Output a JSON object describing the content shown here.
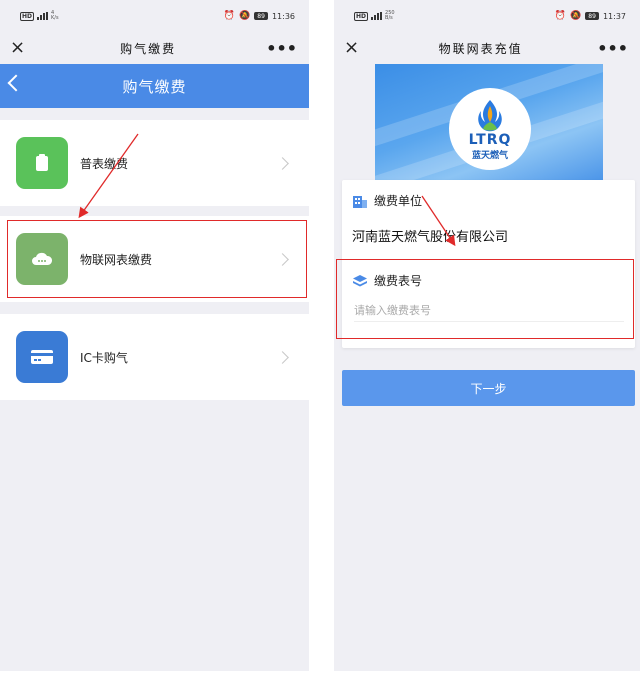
{
  "left": {
    "status": {
      "net_speed": "4\nK/s",
      "time": "11:36",
      "battery": "89"
    },
    "titlebar": {
      "title": "购气缴费",
      "close": "×",
      "more": "•••"
    },
    "header": {
      "title": "购气缴费"
    },
    "menu": [
      {
        "label": "普表缴费",
        "color": "#5ac25a"
      },
      {
        "label": "物联网表缴费",
        "color": "#7cb36b"
      },
      {
        "label": "IC卡购气",
        "color": "#3a7bd5"
      }
    ]
  },
  "right": {
    "status": {
      "net_speed": "250\nB/s",
      "time": "11:37",
      "battery": "89"
    },
    "titlebar": {
      "title": "物联网表充值",
      "close": "×",
      "more": "•••"
    },
    "banner": {
      "logo_text": "LTRQ",
      "logo_sub": "蓝天燃气"
    },
    "form": {
      "unit_label": "缴费单位",
      "unit_value": "河南蓝天燃气股份有限公司",
      "meter_label": "缴费表号",
      "meter_placeholder": "请输入缴费表号",
      "meter_value": ""
    },
    "next_button": "下一步"
  },
  "colors": {
    "header_blue": "#4a8ae6",
    "button_blue": "#5a97ec",
    "annotation_red": "#e02a2a"
  }
}
